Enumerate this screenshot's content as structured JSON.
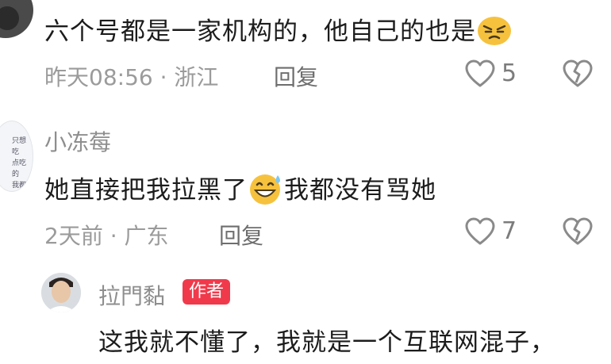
{
  "comments": [
    {
      "text_before": "六个号都是一家机构的，他自己的也是",
      "emoji": "angry-face-emoji",
      "meta": "昨天08:56 · 浙江",
      "reply_label": "回复",
      "like_count": "5"
    },
    {
      "username": "小冻莓",
      "avatar_text": [
        "只想吃",
        "点吃的",
        "我都吃"
      ],
      "text_before": "她直接把我拉黑了",
      "emoji": "grin-sweat-emoji",
      "text_after": "我都没有骂她",
      "meta": "2天前 · 广东",
      "reply_label": "回复",
      "like_count": "7"
    },
    {
      "username": "拉門黏",
      "badge": "作者",
      "text": "这我就不懂了，我就是一个互联网混子，"
    }
  ],
  "colors": {
    "badge": "#f03a4b",
    "meta": "#9b9b9b",
    "text": "#1c1c1c"
  }
}
